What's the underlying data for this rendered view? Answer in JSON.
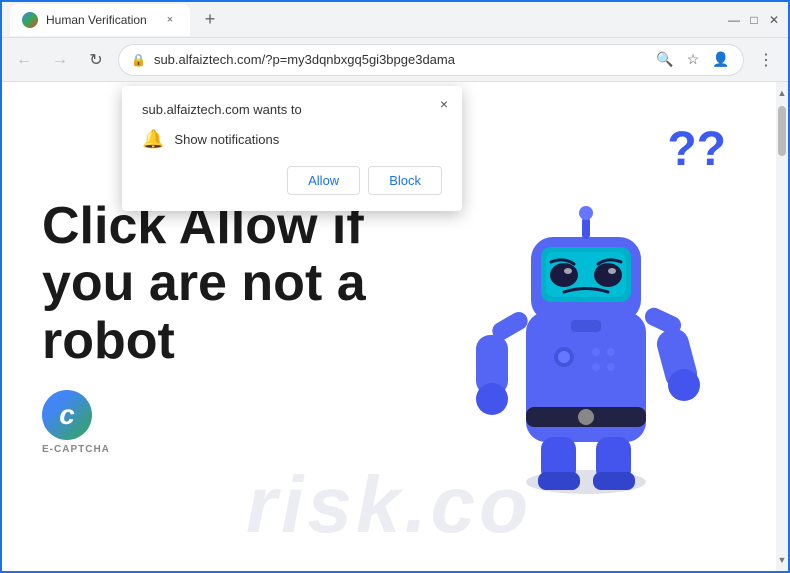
{
  "browser": {
    "tab": {
      "title": "Human Verification",
      "close_label": "×"
    },
    "new_tab_label": "+",
    "window_controls": {
      "minimize": "—",
      "maximize": "□",
      "close": "✕"
    },
    "nav": {
      "back_label": "←",
      "forward_label": "→",
      "reload_label": "↻",
      "url": "sub.alfaiztech.com/?p=my3dqnbxgq5gi3bpge3dama",
      "search_label": "🔍",
      "bookmark_label": "☆",
      "profile_label": "👤",
      "menu_label": "⋮",
      "download_label": "⬇"
    }
  },
  "popup": {
    "title": "sub.alfaiztech.com wants to",
    "notification_text": "Show notifications",
    "close_label": "×",
    "allow_label": "Allow",
    "block_label": "Block"
  },
  "page": {
    "main_text_line1": "Click Allow if",
    "main_text_line2": "you are not a",
    "main_text_line3": "robot",
    "captcha_label": "E-CAPTCHA",
    "question_marks": "??",
    "watermark": "risk.co"
  },
  "colors": {
    "brand_blue": "#1a73e8",
    "robot_body": "#4a5af0",
    "robot_dark": "#3344dd",
    "accent": "#3d5af1"
  }
}
